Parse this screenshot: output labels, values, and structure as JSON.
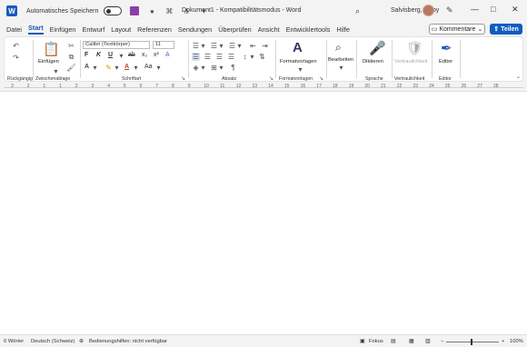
{
  "titlebar": {
    "autosave_label": "Automatisches Speichern",
    "doc_title": "Dokument1  -  Kompatibilitätsmodus  -  Word",
    "user_name": "Salvisberg, Gaby"
  },
  "menu": {
    "tabs": [
      "Datei",
      "Start",
      "Einfügen",
      "Entwurf",
      "Layout",
      "Referenzen",
      "Sendungen",
      "Überprüfen",
      "Ansicht",
      "Entwicklertools",
      "Hilfe"
    ],
    "active_index": 1,
    "comments_label": "Kommentare",
    "share_label": "Teilen"
  },
  "ribbon": {
    "undo_group_label": "Rückgängig",
    "clipboard_group_label": "Zwischenablage",
    "paste_label": "Einfügen",
    "font_group_label": "Schriftart",
    "font_name": "Calibri (Textkörper)",
    "font_size": "11",
    "paragraph_group_label": "Absatz",
    "styles_button_label": "Formatvorlagen",
    "styles_group_label": "Formatvorlagen",
    "editing_label": "Bearbeiten",
    "dictate_label": "Diktieren",
    "voice_group_label": "Sprache",
    "confidentiality_label": "Vertraulichkeit",
    "confidentiality_group_label": "Vertraulichkeit",
    "editor_label": "Editor",
    "editor_group_label": "Editor"
  },
  "ruler": {
    "numbers": [
      "3",
      "2",
      "1",
      "1",
      "2",
      "3",
      "4",
      "5",
      "6",
      "7",
      "8",
      "9",
      "10",
      "11",
      "12",
      "13",
      "14",
      "15",
      "16",
      "17",
      "18",
      "19",
      "20",
      "21",
      "22",
      "23",
      "24",
      "25",
      "26",
      "27",
      "28"
    ]
  },
  "status": {
    "words": "0 Wörter",
    "language": "Deutsch (Schweiz)",
    "accessibility": "Bedienungshilfen: nicht verfügbar",
    "focus": "Fokus",
    "zoom": "100%"
  },
  "colors": {
    "accent": "#185abd",
    "share": "#0f5cc0"
  }
}
